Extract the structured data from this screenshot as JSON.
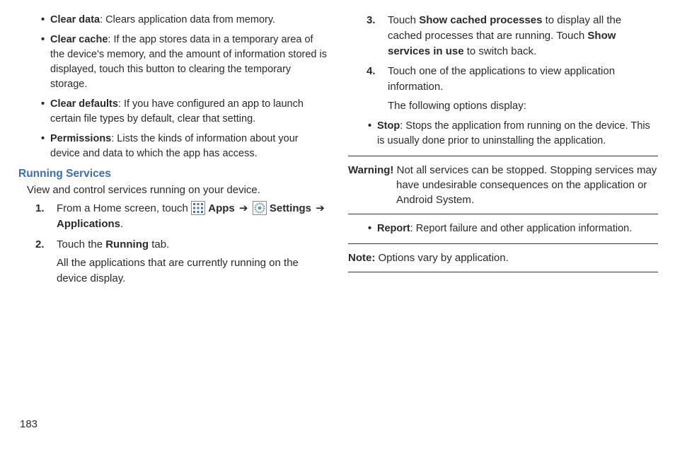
{
  "left": {
    "bullets": {
      "clear_data": {
        "label": "Clear data",
        "desc": ": Clears application data from memory."
      },
      "clear_cache": {
        "label": "Clear cache",
        "desc": ": If the app stores data in a temporary area of the device's memory, and the amount of information stored is displayed, touch this button to clearing the temporary storage."
      },
      "clear_defaults": {
        "label": "Clear defaults",
        "desc": ": If you have configured an app to launch certain file types by default, clear that setting."
      },
      "permissions": {
        "label": "Permissions",
        "desc": ": Lists the kinds of information about your device and data to which the app has access."
      }
    },
    "heading": "Running Services",
    "intro": "View and control services running on your device.",
    "steps": {
      "s1": {
        "num": "1.",
        "pre": "From a Home screen, touch ",
        "apps": "Apps",
        "settings": "Settings",
        "applications": "Applications",
        "arrow": "➔",
        "period": "."
      },
      "s2": {
        "num": "2.",
        "pre": "Touch the ",
        "running": "Running",
        "post": " tab.",
        "sub": "All the applications that are currently running on the device display."
      }
    }
  },
  "right": {
    "steps": {
      "s3": {
        "num": "3.",
        "t1": "Touch ",
        "b1": "Show cached processes",
        "t2": " to display all the cached processes that are running. Touch ",
        "b2": "Show services in use",
        "t3": " to switch back."
      },
      "s4": {
        "num": "4.",
        "t1": "Touch one of the applications to view application information.",
        "sub": "The following options display:"
      }
    },
    "bullets": {
      "stop": {
        "label": "Stop",
        "desc": ": Stops the application from running on the device. This is usually done prior to uninstalling the application."
      },
      "report": {
        "label": "Report",
        "desc": ": Report failure and other application information."
      }
    },
    "warning": {
      "label": "Warning! ",
      "text": "Not all services can be stopped. Stopping services may have undesirable consequences on the application or Android System."
    },
    "note": {
      "label": "Note: ",
      "text": "Options vary by application."
    }
  },
  "page_number": "183"
}
